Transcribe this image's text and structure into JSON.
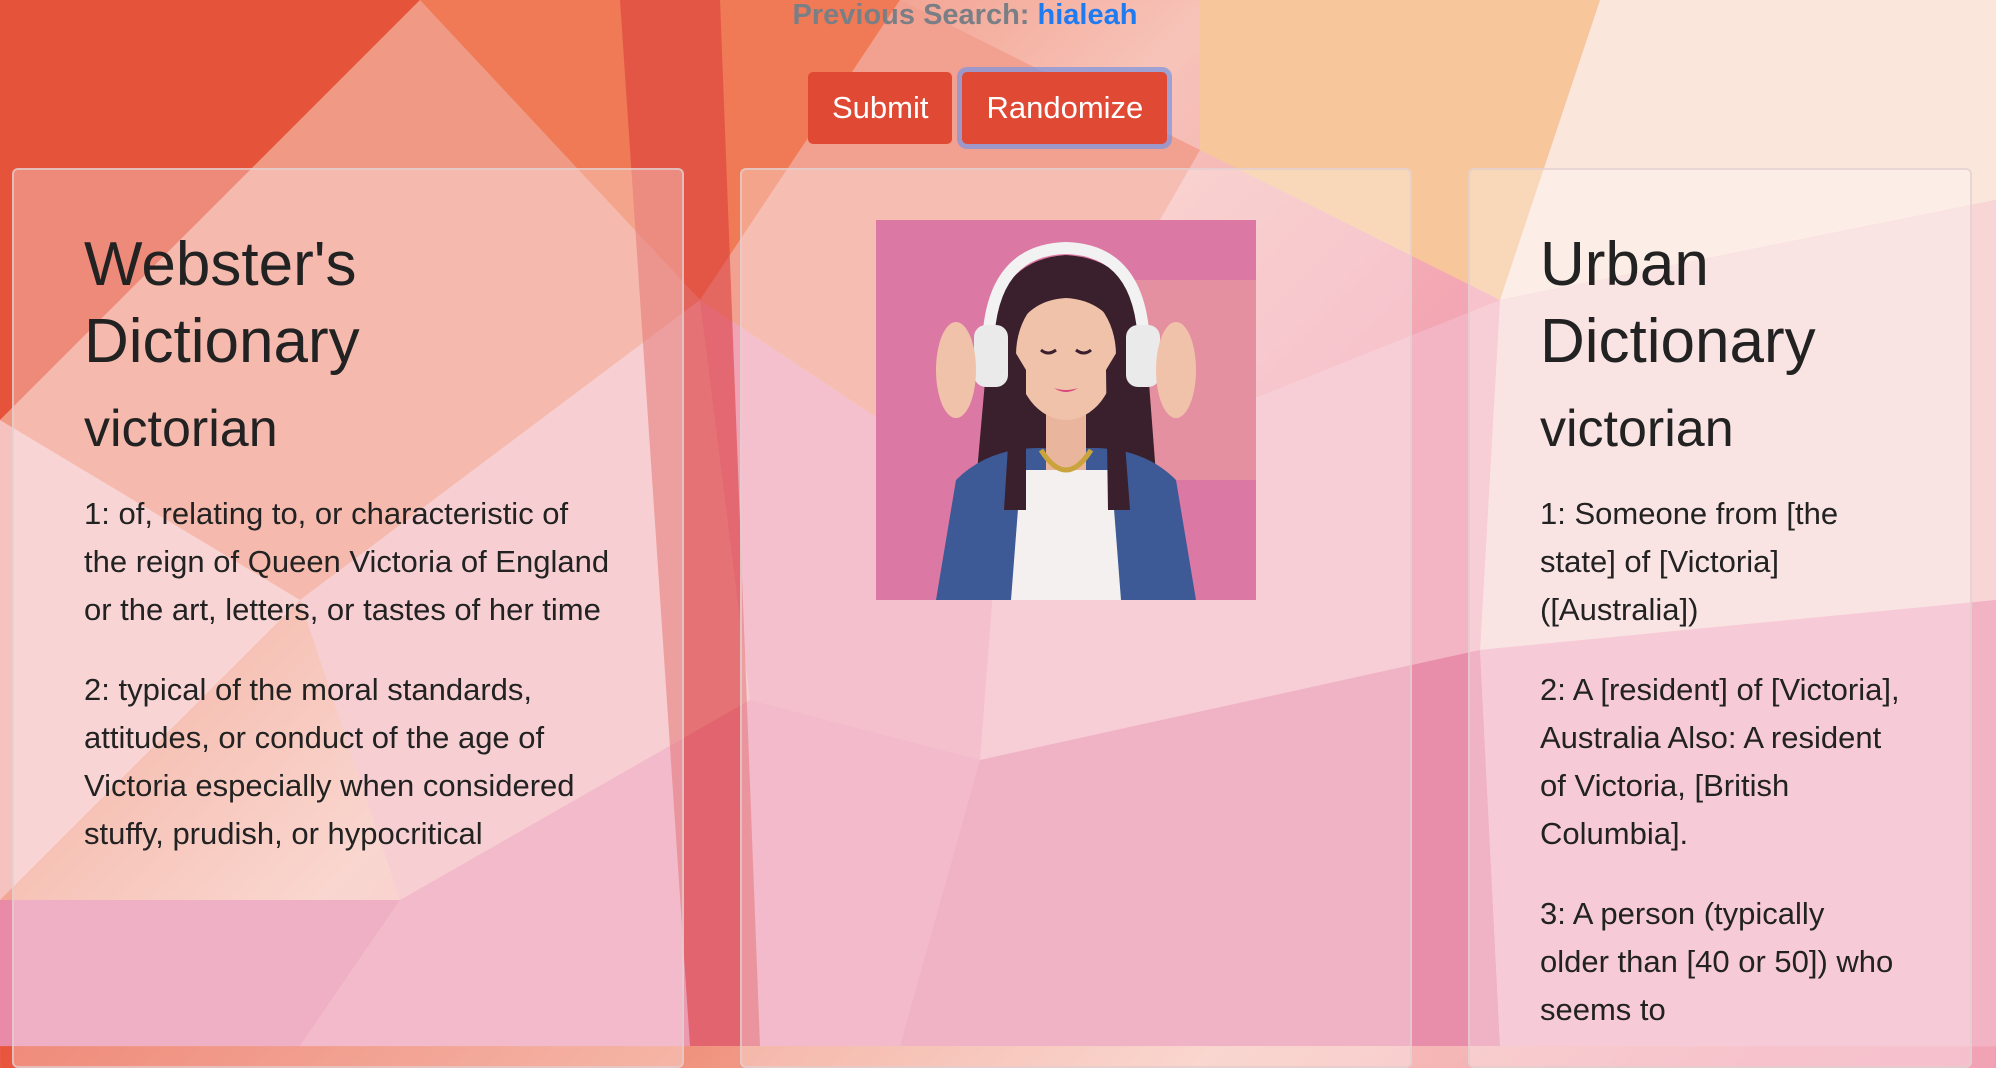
{
  "header": {
    "previous_search_label": "Previous Search:",
    "previous_search_term": "hialeah"
  },
  "buttons": {
    "submit_label": "Submit",
    "randomize_label": "Randomize"
  },
  "webster": {
    "title": "Webster's Dictionary",
    "word": "victorian",
    "definitions": [
      "1: of, relating to, or characteristic of the reign of Queen Victoria of England or the art, letters, or tastes of her time",
      "2: typical of the moral standards, attitudes, or conduct of the age of Victoria especially when considered stuffy, prudish, or hypocritical"
    ]
  },
  "image": {
    "description_icon": "photo-woman-headphones"
  },
  "urban": {
    "title": "Urban Dictionary",
    "word": "victorian",
    "definitions": [
      "1: Someone from [the state] of [Victoria] ([Australia])",
      "2: A [resident] of [Victoria], Australia Also: A resident of Victoria, [British Columbia].",
      "3: A person (typically older than [40 or 50]) who seems to"
    ]
  },
  "colors": {
    "button": "#e04a35",
    "prev_search_label": "#7a7f86",
    "prev_search_term": "#1f7bf2"
  }
}
